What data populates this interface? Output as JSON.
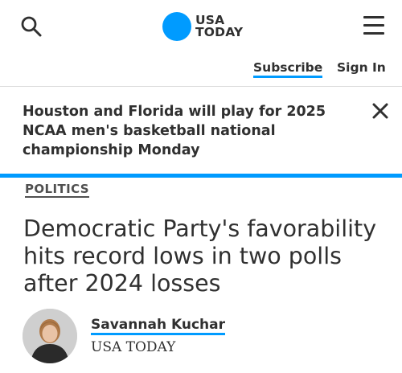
{
  "header": {
    "logo": {
      "line1": "USA",
      "line2": "TODAY",
      "dot_color": "#009bff"
    },
    "search_icon": "search-icon",
    "menu_icon": "hamburger-menu-icon"
  },
  "subbar": {
    "subscribe_label": "Subscribe",
    "signin_label": "Sign In"
  },
  "alert": {
    "text": "Houston and Florida will play for 2025 NCAA men's basketball national championship Monday",
    "close_icon": "close-icon"
  },
  "article": {
    "section": "POLITICS",
    "headline": "Democratic Party's favorability hits record lows in two polls after 2024 losses",
    "author": "Savannah Kuchar",
    "publication": "USA TODAY"
  },
  "colors": {
    "accent": "#009bff",
    "text": "#303030"
  }
}
